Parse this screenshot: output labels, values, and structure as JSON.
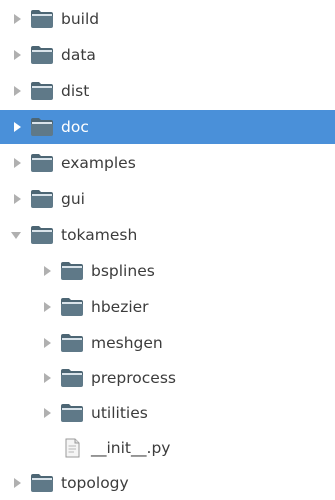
{
  "colors": {
    "selection": "#4a90d9",
    "arrow": "#b0b0b0",
    "arrow_selected": "#ffffff",
    "folder_body": "#5f7988",
    "folder_tab": "#4d6674",
    "folder_inner": "#d9e3ea"
  },
  "tree": [
    {
      "label": "build",
      "icon": "folder-icon",
      "expander": "collapsed"
    },
    {
      "label": "data",
      "icon": "folder-icon",
      "expander": "collapsed"
    },
    {
      "label": "dist",
      "icon": "folder-icon",
      "expander": "collapsed"
    },
    {
      "label": "doc",
      "icon": "folder-icon",
      "expander": "collapsed",
      "selected": true
    },
    {
      "label": "examples",
      "icon": "folder-icon",
      "expander": "collapsed"
    },
    {
      "label": "gui",
      "icon": "folder-icon",
      "expander": "collapsed"
    },
    {
      "label": "tokamesh",
      "icon": "folder-icon",
      "expander": "expanded",
      "children": [
        {
          "label": "bsplines",
          "icon": "folder-icon",
          "expander": "collapsed"
        },
        {
          "label": "hbezier",
          "icon": "folder-icon",
          "expander": "collapsed"
        },
        {
          "label": "meshgen",
          "icon": "folder-icon",
          "expander": "collapsed"
        },
        {
          "label": "preprocess",
          "icon": "folder-icon",
          "expander": "collapsed"
        },
        {
          "label": "utilities",
          "icon": "folder-icon",
          "expander": "collapsed"
        },
        {
          "label": "__init__.py",
          "icon": "python-file-icon",
          "expander": "none"
        }
      ]
    },
    {
      "label": "topology",
      "icon": "folder-icon",
      "expander": "collapsed"
    }
  ]
}
